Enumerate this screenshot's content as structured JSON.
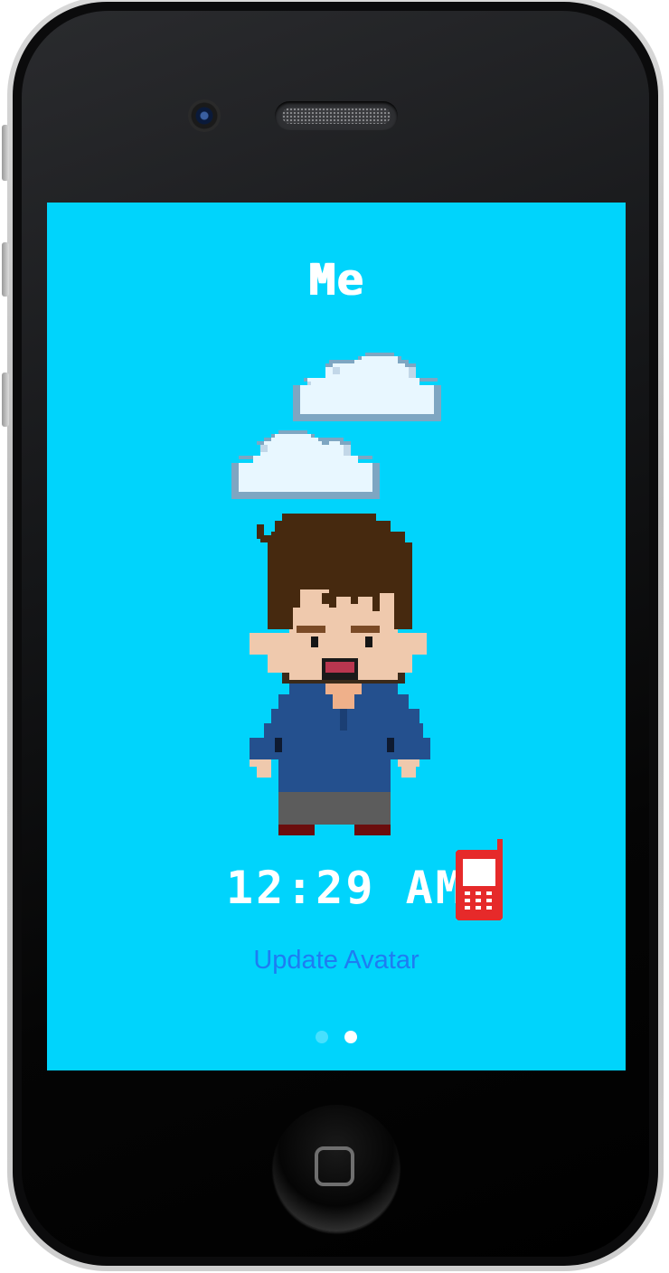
{
  "screen": {
    "title": "Me",
    "clock_time": "12:29",
    "clock_ampm": "AM",
    "update_link_label": "Update Avatar",
    "page_dots": {
      "count": 2,
      "active_index": 1
    },
    "background_color": "#00d4fc"
  },
  "icons": {
    "phone": "mobile-phone-icon",
    "clouds": "cloud-icon",
    "avatar": "pixel-avatar"
  },
  "colors": {
    "link": "#1e7cf2",
    "phone_icon": "#e62a2a",
    "hair": "#4a2a12",
    "skin": "#efc9ad",
    "shirt": "#24508e",
    "pants": "#5a5a5a"
  }
}
